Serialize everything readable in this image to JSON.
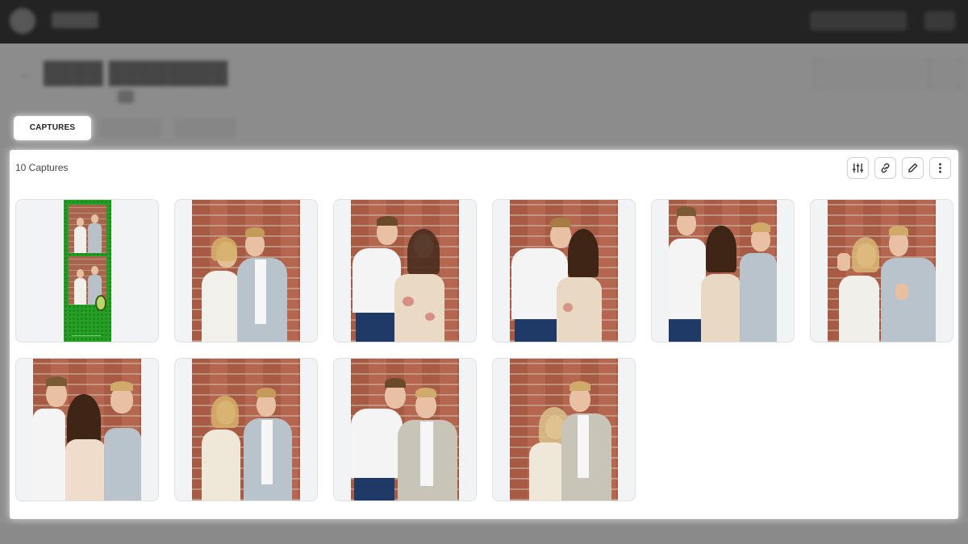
{
  "tabs": {
    "captures_label": "CAPTURES"
  },
  "panel": {
    "count_label": "10 Captures"
  },
  "toolbar_icons": [
    "sliders-icon",
    "link-icon",
    "pencil-icon",
    "more-vertical-icon"
  ],
  "captures": [
    {
      "kind": "strip"
    },
    {
      "kind": "photo"
    },
    {
      "kind": "photo"
    },
    {
      "kind": "photo"
    },
    {
      "kind": "photo"
    },
    {
      "kind": "photo"
    },
    {
      "kind": "photo"
    },
    {
      "kind": "photo"
    },
    {
      "kind": "photo"
    },
    {
      "kind": "photo"
    }
  ],
  "colors": {
    "panel_bg": "#ffffff",
    "dim_overlay": "#8e8e8e",
    "card_bg": "#f2f3f5",
    "strip_green": "#25a025",
    "brick": "#b0654d"
  }
}
